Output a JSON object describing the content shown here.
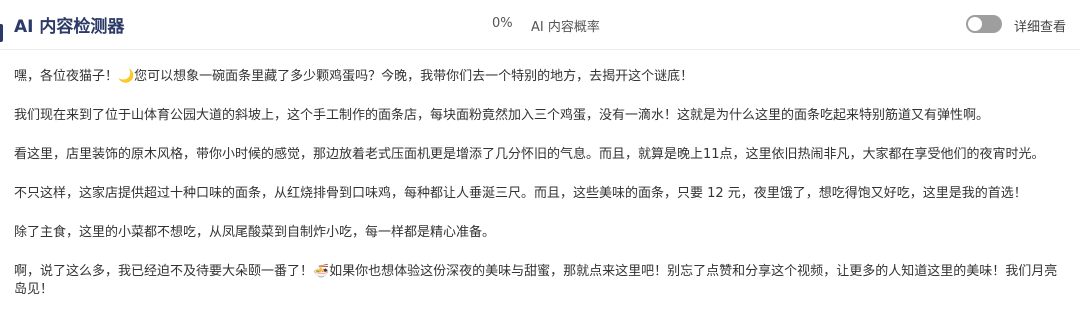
{
  "header": {
    "title": "AI 内容检测器",
    "percent": "0%",
    "probability_label": "AI 内容概率",
    "detail_label": "详细查看",
    "toggle_on": false
  },
  "content": {
    "paragraphs": [
      "嘿，各位夜猫子！🌙您可以想象一碗面条里藏了多少颗鸡蛋吗？今晚，我带你们去一个特别的地方，去揭开这个谜底！",
      "我们现在来到了位于山体育公园大道的斜坡上，这个手工制作的面条店，每块面粉竟然加入三个鸡蛋，没有一滴水！这就是为什么这里的面条吃起来特别筋道又有弹性啊。",
      "看这里，店里装饰的原木风格，带你小时候的感觉，那边放着老式压面机更是增添了几分怀旧的气息。而且，就算是晚上11点，这里依旧热闹非凡，大家都在享受他们的夜宵时光。",
      "不只这样，这家店提供超过十种口味的面条，从红烧排骨到口味鸡，每种都让人垂涎三尺。而且，这些美味的面条，只要 12 元，夜里饿了，想吃得饱又好吃，这里是我的首选！",
      "除了主食，这里的小菜都不想吃，从凤尾酸菜到自制炸小吃，每一样都是精心准备。",
      "啊，说了这么多，我已经迫不及待要大朵颐一番了！🍜如果你也想体验这份深夜的美味与甜蜜，那就点来这里吧！别忘了点赞和分享这个视频，让更多的人知道这里的美味！我们月亮岛见！"
    ]
  },
  "colors": {
    "title": "#2b3a67",
    "toggle_off": "#9e9e9e",
    "text": "#333333"
  }
}
